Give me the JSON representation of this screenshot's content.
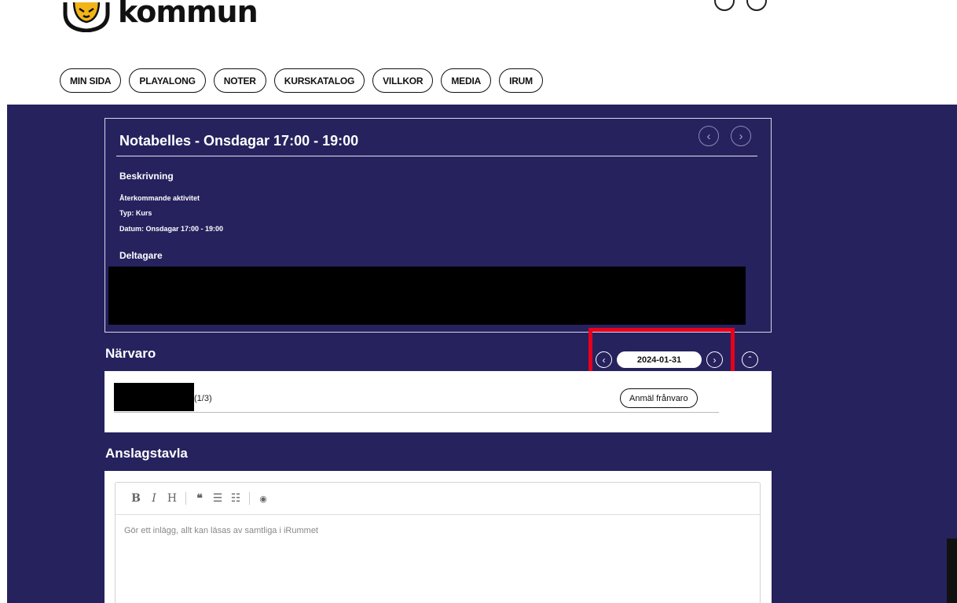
{
  "header": {
    "logo_text": "kommun"
  },
  "nav": {
    "items": [
      "MIN SIDA",
      "PLAYALONG",
      "NOTER",
      "KURSKATALOG",
      "VILLKOR",
      "MEDIA",
      "IRUM"
    ]
  },
  "activity": {
    "title": "Notabelles - Onsdagar 17:00 - 19:00",
    "description_heading": "Beskrivning",
    "recurring": "Återkommande aktivitet",
    "type": "Typ: Kurs",
    "date": "Datum: Onsdagar 17:00 - 19:00",
    "participants_heading": "Deltagare",
    "prev_icon": "chevron-left",
    "next_icon": "chevron-right"
  },
  "attendance": {
    "heading": "Närvaro",
    "date": "2024-01-31",
    "count_suffix": "(1/3)",
    "report_absence": "Anmäl frånvaro"
  },
  "board": {
    "heading": "Anslagstavla",
    "placeholder": "Gör ett inlägg, allt kan läsas av samtliga i iRummet",
    "toolbar": [
      "B",
      "I",
      "H",
      "❝",
      "☰",
      "☷",
      "◉"
    ]
  },
  "colors": {
    "band": "#26225e",
    "highlight": "#e8001c"
  }
}
